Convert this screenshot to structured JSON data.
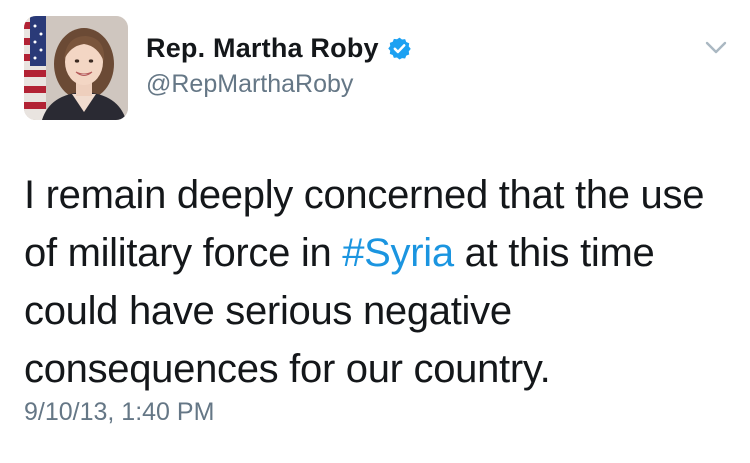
{
  "author": {
    "display_name": "Rep. Martha Roby",
    "handle": "@RepMarthaRoby",
    "verified_icon": "verified-badge-icon",
    "avatar_icon": "profile-photo"
  },
  "menu": {
    "icon": "chevron-down-icon"
  },
  "tweet": {
    "text_before": "I remain deeply concerned that the use of military force in ",
    "hashtag": "#Syria",
    "text_after": " at this time could have serious negative consequences for our country.",
    "timestamp": "9/10/13, 1:40 PM"
  },
  "colors": {
    "name": "#14171a",
    "secondary": "#657786",
    "link": "#1b95e0",
    "verified": "#1da1f2",
    "background": "#ffffff"
  }
}
